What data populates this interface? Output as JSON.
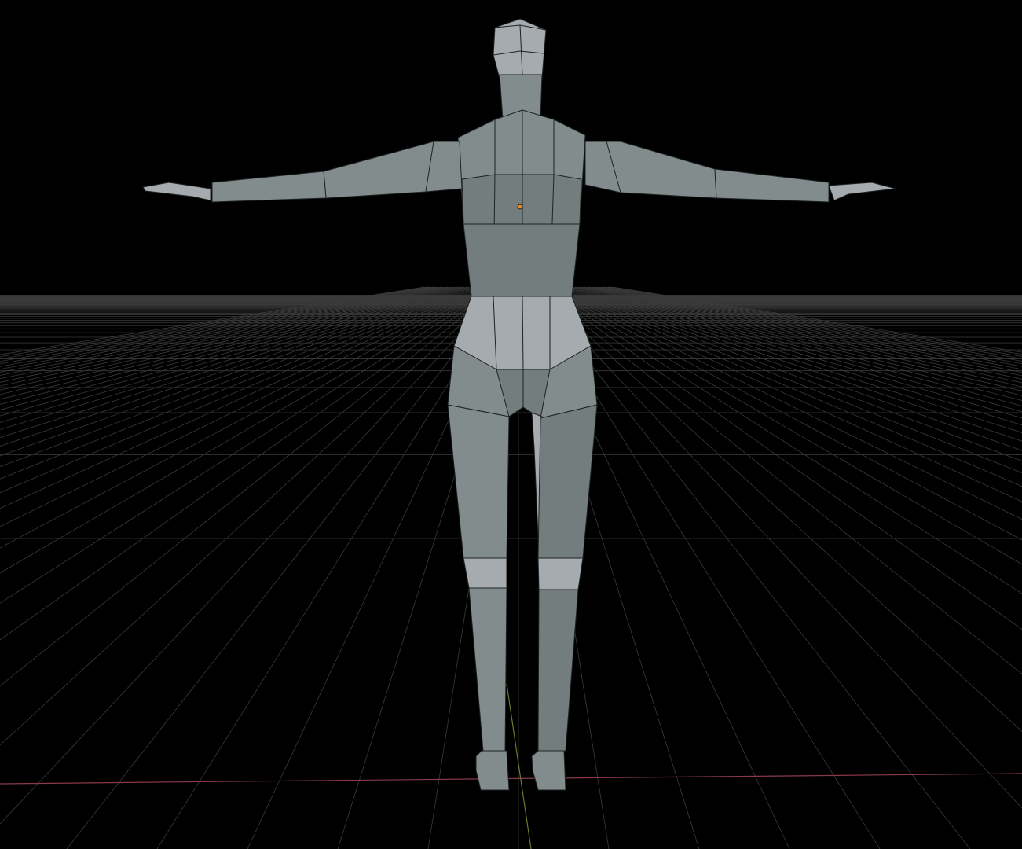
{
  "viewport": {
    "background": "#000000",
    "grid_color": "#3a3a3a",
    "x_axis_color": "#8a3a4a",
    "y_axis_color": "#6b7a2a",
    "mesh_light": "#a5abae",
    "mesh_mid": "#838c8c",
    "mesh_dark": "#737d7d",
    "origin_color": "#e08a2a"
  }
}
